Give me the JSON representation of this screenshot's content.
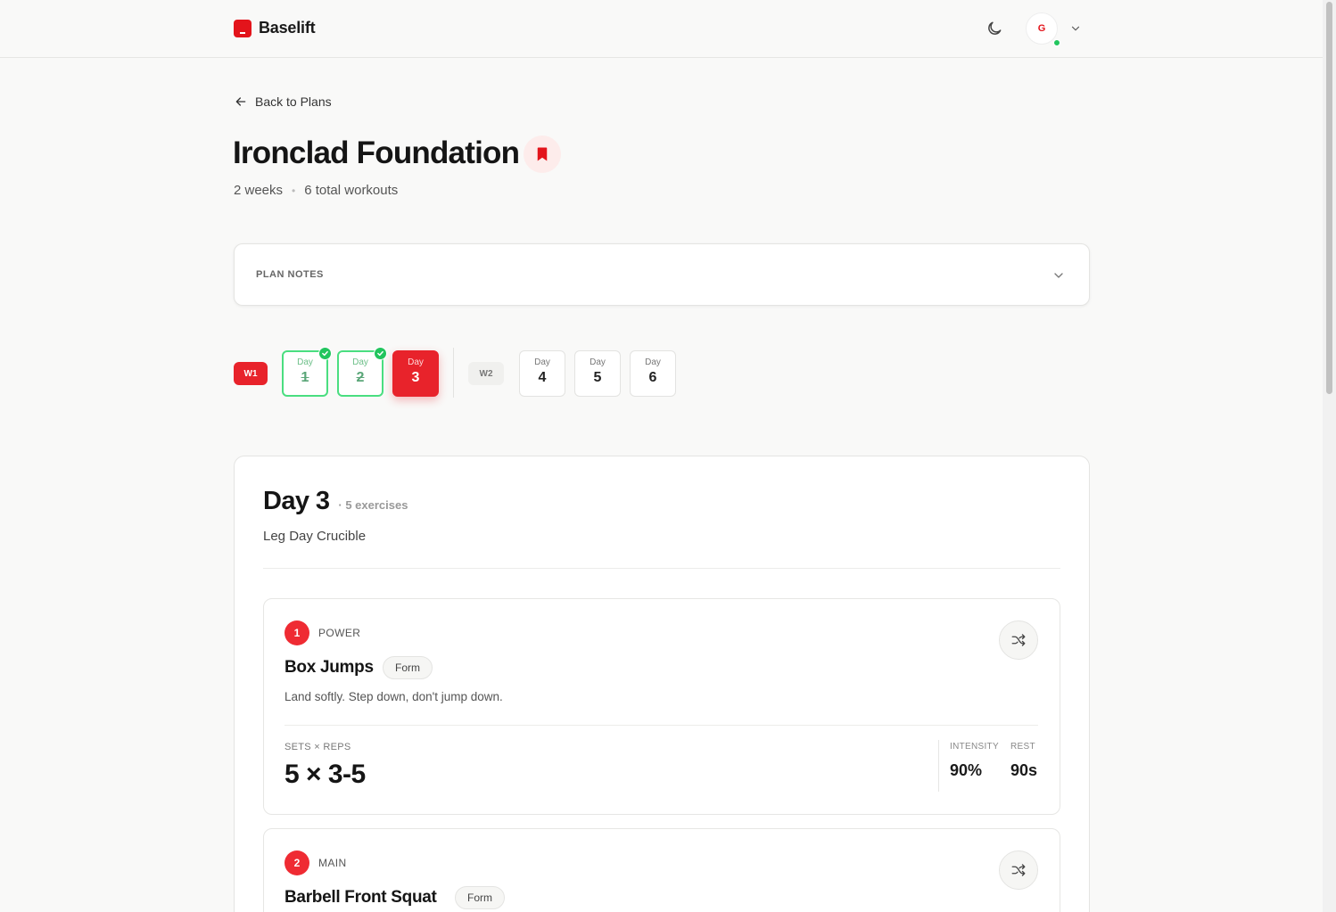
{
  "header": {
    "brand_name": "Baselift",
    "avatar_initial": "G"
  },
  "nav": {
    "back_label": "Back to Plans"
  },
  "plan": {
    "title": "Ironclad Foundation",
    "weeks": "2 weeks",
    "total_workouts": "6 total workouts",
    "notes_label": "PLAN NOTES"
  },
  "schedule": {
    "weeks": [
      {
        "label": "W1",
        "days": [
          {
            "label": "Day",
            "number": "1",
            "status": "completed"
          },
          {
            "label": "Day",
            "number": "2",
            "status": "completed"
          },
          {
            "label": "Day",
            "number": "3",
            "status": "active"
          }
        ]
      },
      {
        "label": "W2",
        "days": [
          {
            "label": "Day",
            "number": "4",
            "status": "upcoming"
          },
          {
            "label": "Day",
            "number": "5",
            "status": "upcoming"
          },
          {
            "label": "Day",
            "number": "6",
            "status": "upcoming"
          }
        ]
      }
    ]
  },
  "workout": {
    "title": "Day 3",
    "exercise_count": "· 5 exercises",
    "subtitle": "Leg Day Crucible",
    "exercises": [
      {
        "index": "1",
        "category": "POWER",
        "name": "Box Jumps",
        "form_label": "Form",
        "note": "Land softly. Step down, don't jump down.",
        "sets_reps_label": "SETS × REPS",
        "sets_reps": "5 × 3-5",
        "intensity_label": "INTENSITY",
        "intensity": "90%",
        "rest_label": "REST",
        "rest": "90s"
      },
      {
        "index": "2",
        "category": "MAIN",
        "name": "Barbell Front Squat",
        "form_label": "Form"
      }
    ]
  },
  "colors": {
    "accent": "#e8232b",
    "completed": "#22c55e",
    "background": "#f9f9f8"
  },
  "icons": {
    "theme_toggle": "moon-icon",
    "back": "arrow-left-icon",
    "bookmark": "bookmark-icon",
    "notes_toggle": "chevron-down-icon",
    "swap": "shuffle-icon",
    "completed": "check-icon"
  }
}
